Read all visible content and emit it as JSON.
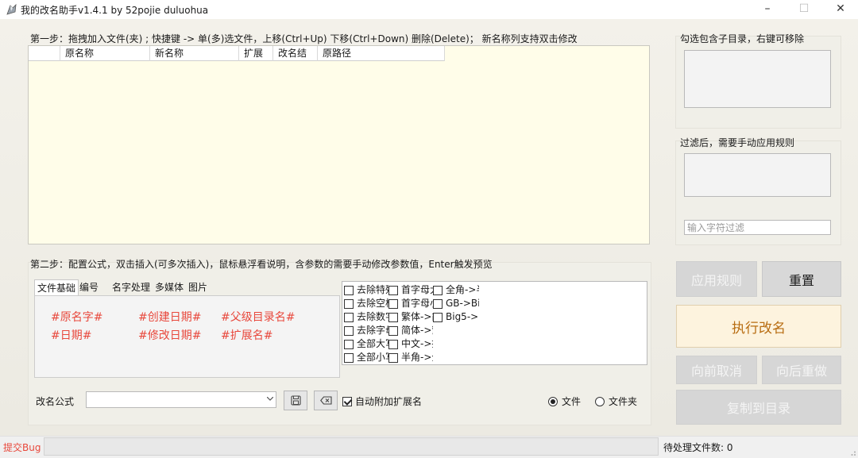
{
  "window": {
    "title": "我的改名助手v1.4.1 by 52pojie duluohua",
    "controls": {
      "minimize": "–",
      "maximize": "☐",
      "close": "✕"
    }
  },
  "step1": {
    "label": "第一步：拖拽加入文件(夹) ; 快捷键 -> 单(多)选文件，上移(Ctrl+Up) 下移(Ctrl+Down) 删除(Delete)；  新名称列支持双击修改",
    "columns": [
      "",
      "原名称",
      "新名称",
      "扩展",
      "改名结",
      "原路径"
    ]
  },
  "right_panel": {
    "subdir_label": "勾选包含子目录，右键可移除",
    "filter_label": "过滤后，需要手动应用规则",
    "filter_placeholder": "输入字符过滤",
    "buttons": {
      "apply": "应用规则",
      "reset": "重置",
      "run": "执行改名",
      "undo": "向前取消",
      "redo": "向后重做",
      "copy_to": "复制到目录"
    }
  },
  "step2": {
    "label": "第二步：配置公式，双击插入(可多次插入)，鼠标悬浮看说明，含参数的需要手动修改参数值，Enter触发预览",
    "tabs": [
      "文件基础",
      "编号",
      "名字处理",
      "多媒体",
      "图片"
    ],
    "variables": [
      "#原名字#",
      "#创建日期#",
      "#父级目录名#",
      "#日期#",
      "#修改日期#",
      "#扩展名#"
    ],
    "options": [
      [
        "去除特殊",
        "首字母大",
        "全角->半"
      ],
      [
        "去除空格",
        "首字母小",
        "GB->Bi"
      ],
      [
        "去除数字",
        "繁体->简",
        "Big5->"
      ],
      [
        "去除字母",
        "简体->繁",
        ""
      ],
      [
        "全部大写",
        "中文->拼",
        ""
      ],
      [
        "全部小写",
        "半角->全",
        ""
      ]
    ],
    "formula_label": "改名公式",
    "formula_value": "",
    "auto_ext_label": "自动附加扩展名",
    "auto_ext_checked": true,
    "radio_file": "文件",
    "radio_folder": "文件夹",
    "radio_selected": "文件"
  },
  "status": {
    "bug_link": "提交Bug",
    "pending_label": "待处理文件数: 0"
  },
  "colors": {
    "accent_red": "#e8483c",
    "run_text": "#b86d12",
    "list_bg": "#fffde9"
  },
  "icons": [
    "app-icon",
    "save-icon",
    "clear-icon",
    "chevron-down-icon",
    "size-grip-icon"
  ]
}
